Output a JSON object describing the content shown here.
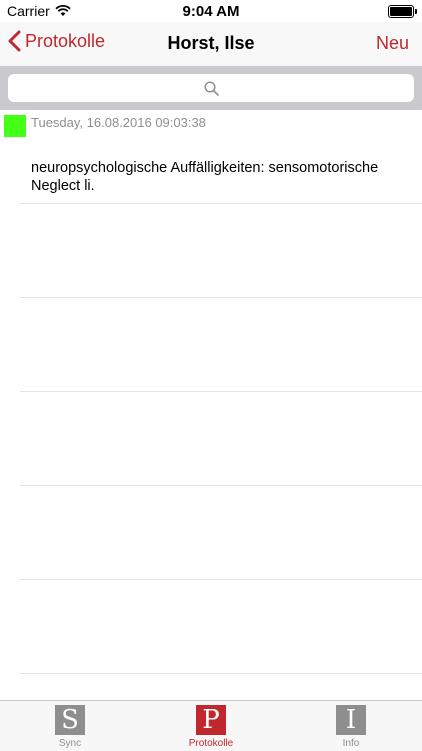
{
  "status_bar": {
    "carrier": "Carrier",
    "time": "9:04 AM"
  },
  "nav": {
    "back_label": "Protokolle",
    "title": "Horst, Ilse",
    "new_label": "Neu"
  },
  "search": {
    "placeholder": ""
  },
  "entries": [
    {
      "timestamp": "Tuesday, 16.08.2016 09:03:38",
      "text": "neuropsychologische Auffälligkeiten: sensomotorische Neglect li.",
      "status_color": "#44ff16"
    }
  ],
  "tabs": [
    {
      "icon_letter": "S",
      "label": "Sync",
      "icon_color": "#8e8e8e"
    },
    {
      "icon_letter": "P",
      "label": "Protokolle",
      "icon_color": "#c0282d"
    },
    {
      "icon_letter": "I",
      "label": "Info",
      "icon_color": "#8e8e8e"
    }
  ],
  "colors": {
    "accent": "#c0282d",
    "search_bar_bg": "#c9c9ce"
  }
}
